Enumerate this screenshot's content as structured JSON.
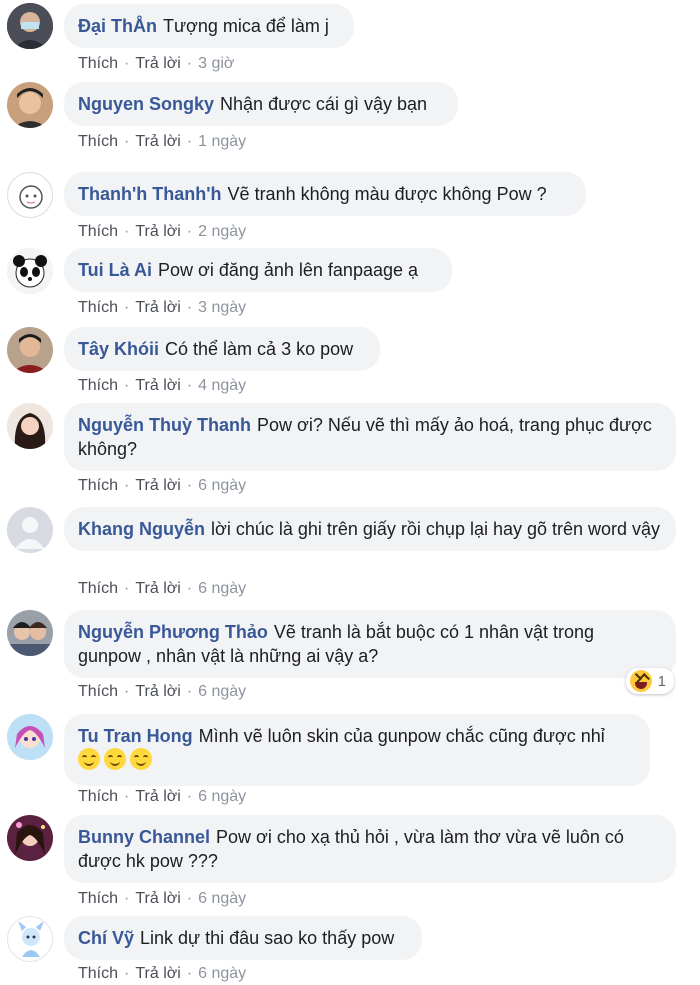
{
  "actions": {
    "like": "Thích",
    "reply": "Trả lời",
    "sep": "·"
  },
  "comments": [
    {
      "author": "Đại ThÅn",
      "text": "Tượng mica để làm j",
      "time": "3 giờ"
    },
    {
      "author": "Nguyen Songky",
      "text": "Nhận được cái gì vậy bạn",
      "time": "1 ngày"
    },
    {
      "author": "Thanh'h Thanh'h",
      "text": "Vẽ tranh không màu được không Pow ?",
      "time": "2 ngày"
    },
    {
      "author": "Tui Là Ai",
      "text": "Pow ơi đăng ảnh lên fanpaage ạ",
      "time": "3 ngày"
    },
    {
      "author": "Tây Khóii",
      "text": "Có thể làm cả 3 ko pow",
      "time": "4 ngày"
    },
    {
      "author": "Nguyễn Thuỳ Thanh",
      "text": "Pow ơi? Nếu vẽ thì mấy ảo hoá, trang phục được không?",
      "time": "6 ngày"
    },
    {
      "author": "Khang Nguyễn",
      "text": "lời chúc là ghi trên giấy rồi chụp lại hay gõ trên word vậy",
      "time": "6 ngày"
    },
    {
      "author": "Nguyễn Phương Thảo",
      "text": "Vẽ tranh là bắt buộc có 1 nhân vật trong gunpow , nhân vật là những ai vậy a?",
      "time": "6 ngày",
      "reaction_count": "1"
    },
    {
      "author": "Tu Tran Hong",
      "text": "Mình vẽ luôn skin của gunpow chắc cũng được nhỉ",
      "time": "6 ngày"
    },
    {
      "author": "Bunny Channel",
      "text": "Pow ơi cho xạ thủ hỏi , vừa làm thơ vừa vẽ luôn có được hk pow ???",
      "time": "6 ngày"
    },
    {
      "author": "Chí Vỹ",
      "text": "Link dự thi đâu sao ko thấy pow",
      "time": "6 ngày"
    }
  ],
  "colors": {
    "author": "#385898",
    "bubble": "#f2f3f5",
    "meta": "#8d949e"
  },
  "icons": {
    "reaction": "haha-reaction-icon",
    "emoji": "smiling-face-icon"
  }
}
